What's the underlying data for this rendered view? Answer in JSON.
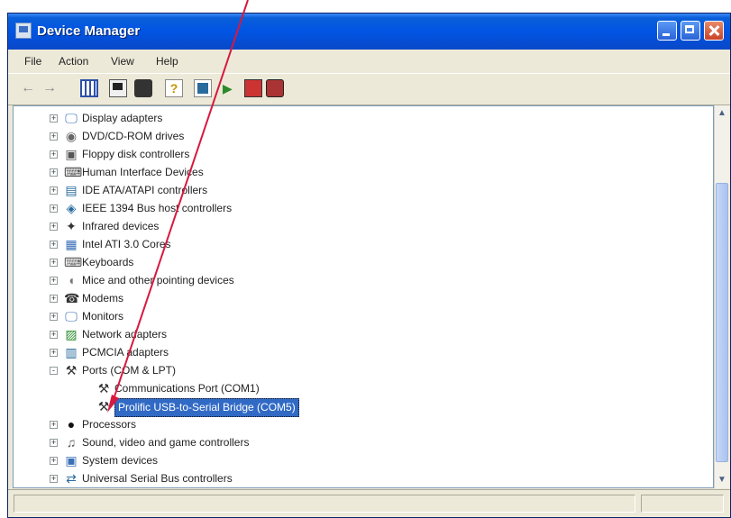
{
  "window": {
    "title": "Device Manager"
  },
  "menu": {
    "file": "File",
    "action": "Action",
    "view": "View",
    "help": "Help"
  },
  "toolbar_icons": [
    "back-arrow-icon",
    "forward-arrow-icon",
    "show-hide-tree-icon",
    "properties-icon",
    "print-icon",
    "help-icon",
    "scan-hardware-icon",
    "update-driver-icon",
    "disable-device-icon",
    "uninstall-device-icon"
  ],
  "tree": {
    "items": [
      {
        "label": "Display adapters",
        "icon": "monitor-icon",
        "expander": "+"
      },
      {
        "label": "DVD/CD-ROM drives",
        "icon": "cdrom-icon",
        "expander": "+"
      },
      {
        "label": "Floppy disk controllers",
        "icon": "floppy-icon",
        "expander": "+"
      },
      {
        "label": "Human Interface Devices",
        "icon": "hid-icon",
        "expander": "+"
      },
      {
        "label": "IDE ATA/ATAPI controllers",
        "icon": "ide-icon",
        "expander": "+"
      },
      {
        "label": "IEEE 1394 Bus host controllers",
        "icon": "ieee1394-icon",
        "expander": "+"
      },
      {
        "label": "Infrared devices",
        "icon": "infrared-icon",
        "expander": "+"
      },
      {
        "label": "Intel ATI 3.0 Cores",
        "icon": "chip-icon",
        "expander": "+"
      },
      {
        "label": "Keyboards",
        "icon": "keyboard-icon",
        "expander": "+"
      },
      {
        "label": "Mice and other pointing devices",
        "icon": "mouse-icon",
        "expander": "+"
      },
      {
        "label": "Modems",
        "icon": "modem-icon",
        "expander": "+"
      },
      {
        "label": "Monitors",
        "icon": "monitor-icon",
        "expander": "+"
      },
      {
        "label": "Network adapters",
        "icon": "network-icon",
        "expander": "+"
      },
      {
        "label": "PCMCIA adapters",
        "icon": "pcmcia-icon",
        "expander": "+"
      },
      {
        "label": "Ports (COM & LPT)",
        "icon": "port-icon",
        "expander": "-"
      },
      {
        "label": "Communications Port (COM1)",
        "icon": "port-icon",
        "child": true
      },
      {
        "label": "Prolific USB-to-Serial Bridge (COM5)",
        "icon": "port-icon",
        "child": true,
        "selected": true
      },
      {
        "label": "Processors",
        "icon": "cpu-icon",
        "expander": "+"
      },
      {
        "label": "Sound, video and game controllers",
        "icon": "sound-icon",
        "expander": "+"
      },
      {
        "label": "System devices",
        "icon": "computer-icon",
        "expander": "+"
      },
      {
        "label": "Universal Serial Bus controllers",
        "icon": "usb-icon",
        "expander": "+"
      }
    ]
  },
  "colors": {
    "title_bar": "#0054e3",
    "selection": "#316ac5",
    "annotation_arrow": "#d6193f"
  }
}
